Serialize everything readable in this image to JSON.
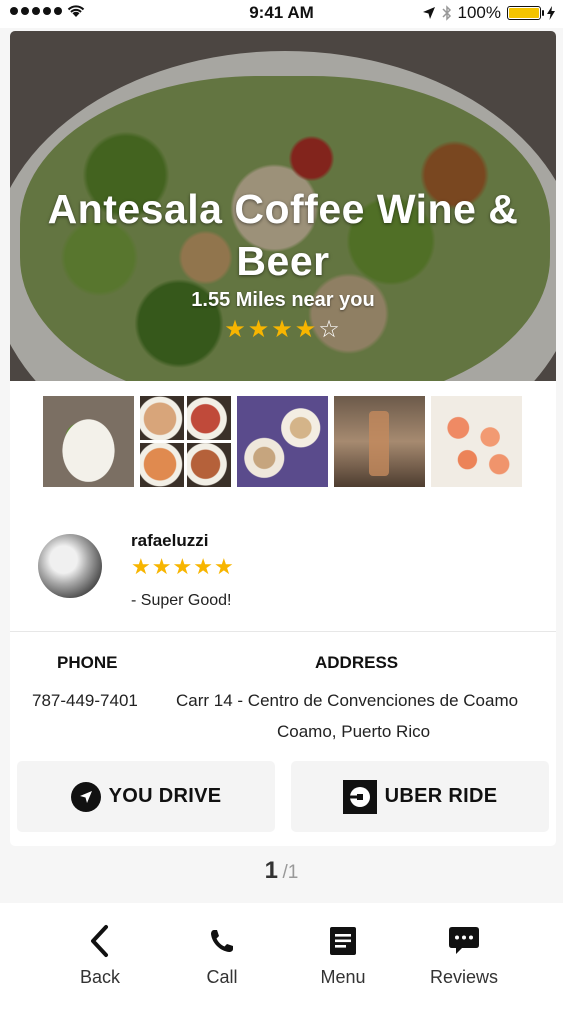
{
  "status_bar": {
    "time": "9:41 AM",
    "battery": "100%"
  },
  "restaurant": {
    "name": "Antesala Coffee Wine & Beer",
    "distance": "1.55 Miles near you",
    "rating": 4,
    "rating_max": 5
  },
  "photos": [
    {
      "icon": "salad-photo"
    },
    {
      "icon": "plates-collage-photo"
    },
    {
      "icon": "coffee-photo"
    },
    {
      "icon": "bar-photo"
    },
    {
      "icon": "smoked-salmon-photo"
    }
  ],
  "review": {
    "author": "rafaeluzzi",
    "rating": 5,
    "text": "- Super Good!"
  },
  "info": {
    "phone_label": "PHONE",
    "phone": "787-449-7401",
    "address_label": "ADDRESS",
    "address_line1": "Carr 14 - Centro de Convenciones de Coamo",
    "address_line2": "Coamo, Puerto Rico"
  },
  "actions": {
    "drive_label": "YOU DRIVE",
    "uber_label": "UBER RIDE"
  },
  "pager": {
    "current": "1",
    "total": "/1"
  },
  "tabs": [
    {
      "label": "Back",
      "icon": "chevron-left-icon"
    },
    {
      "label": "Call",
      "icon": "phone-icon"
    },
    {
      "label": "Menu",
      "icon": "menu-document-icon"
    },
    {
      "label": "Reviews",
      "icon": "chat-bubble-icon"
    }
  ],
  "colors": {
    "star": "#f7b500",
    "battery": "#f4c400",
    "button_bg": "#f4f4f4"
  }
}
